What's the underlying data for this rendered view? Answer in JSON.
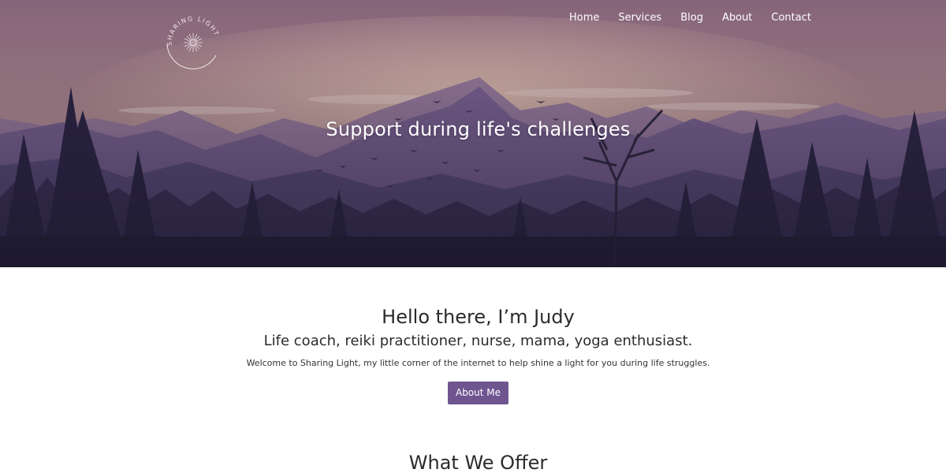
{
  "header": {
    "logo_text": "SHARING LIGHT",
    "nav": [
      {
        "label": "Home"
      },
      {
        "label": "Services"
      },
      {
        "label": "Blog"
      },
      {
        "label": "About"
      },
      {
        "label": "Contact"
      }
    ]
  },
  "hero": {
    "title": "Support during life's challenges"
  },
  "intro": {
    "heading": "Hello there, I’m Judy",
    "subheading": "Life coach, reiki practitioner, nurse, mama, yoga enthusiast.",
    "text": "Welcome to Sharing Light, my little corner of the internet to help shine a light for you during life struggles.",
    "button_label": "About Me"
  },
  "offer": {
    "heading": "What We Offer"
  },
  "colors": {
    "accent": "#6e5590",
    "sky_top": "#8a6b7a",
    "sky_glow": "#d8b4a4",
    "mountain": "#8a6f9e",
    "forest": "#2a2540"
  }
}
